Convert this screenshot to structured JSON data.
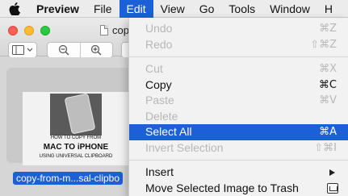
{
  "menubar": {
    "items": [
      {
        "label": "Preview",
        "bold": true
      },
      {
        "label": "File"
      },
      {
        "label": "Edit",
        "active": true
      },
      {
        "label": "View"
      },
      {
        "label": "Go"
      },
      {
        "label": "Tools"
      },
      {
        "label": "Window"
      },
      {
        "label": "H"
      }
    ]
  },
  "window": {
    "title": "cop",
    "thumbnail": {
      "line1": "HOW TO COPY FROM",
      "line2": "MAC TO iPHONE",
      "line3": "USING UNIVERSAL CLIPBOARD"
    },
    "filename": "copy-from-m...sal-clipbo"
  },
  "edit_menu": {
    "undo": {
      "label": "Undo",
      "shortcut": "⌘Z"
    },
    "redo": {
      "label": "Redo",
      "shortcut": "⇧⌘Z"
    },
    "cut": {
      "label": "Cut",
      "shortcut": "⌘X"
    },
    "copy": {
      "label": "Copy",
      "shortcut": "⌘C"
    },
    "paste": {
      "label": "Paste",
      "shortcut": "⌘V"
    },
    "delete": {
      "label": "Delete"
    },
    "select_all": {
      "label": "Select All",
      "shortcut": "⌘A"
    },
    "invert_selection": {
      "label": "Invert Selection",
      "shortcut": "⇧⌘I"
    },
    "insert": {
      "label": "Insert"
    },
    "move_to_trash": {
      "label": "Move Selected Image to Trash"
    }
  },
  "colors": {
    "highlight": "#1b60d6",
    "menu_bg": "#f2f2f2",
    "disabled_text": "#b7b7b7"
  }
}
